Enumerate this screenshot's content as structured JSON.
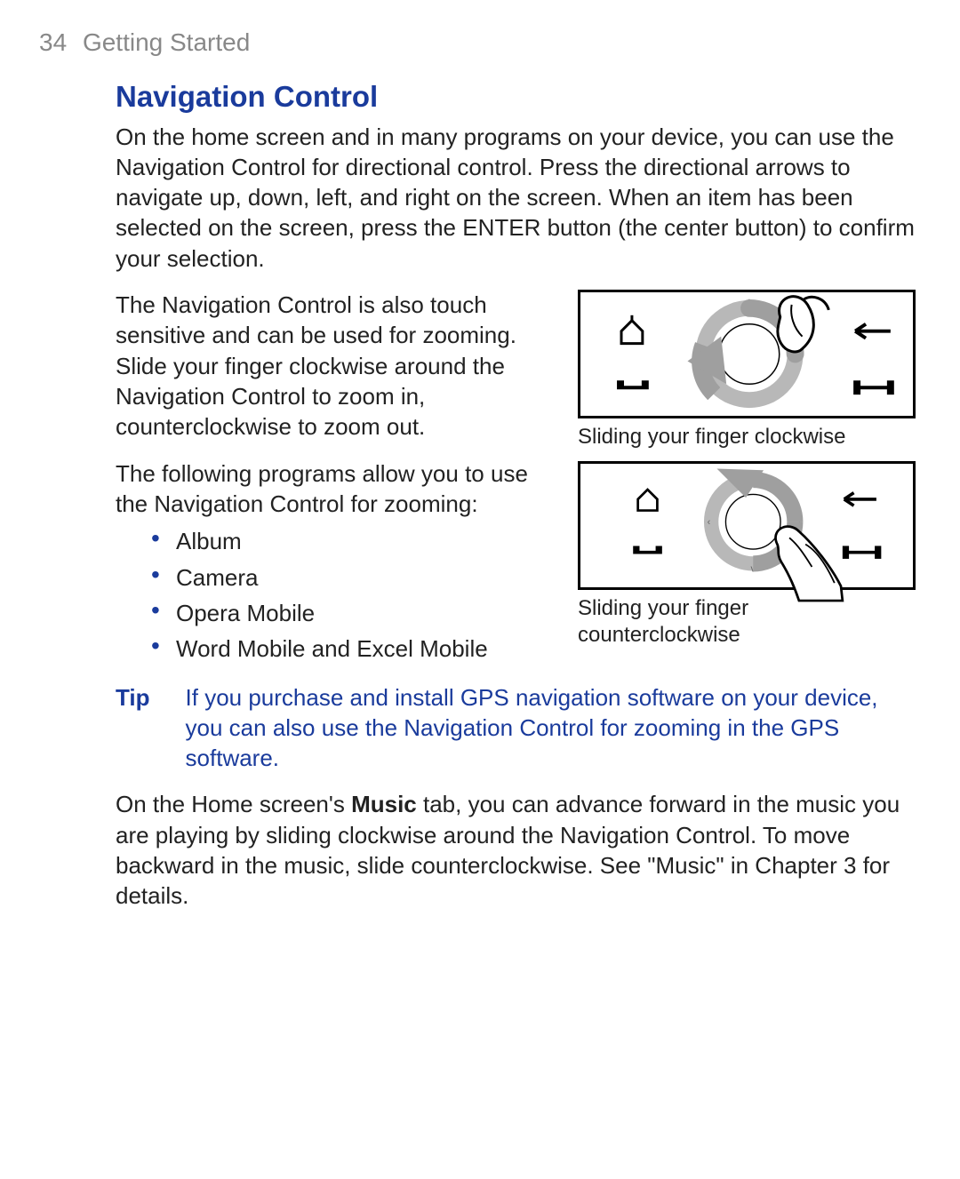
{
  "header": {
    "page_number": "34",
    "chapter": "Getting Started"
  },
  "section_title": "Navigation Control",
  "intro": "On the home screen and in many programs on your device, you can use the Navigation Control for directional control. Press the directional arrows to navigate up, down, left, and right on the screen. When an item has been selected on the screen, press the ENTER button (the center button) to confirm your selection.",
  "touch_para": "The Navigation Control is also touch sensitive and can be used for zooming. Slide your finger clockwise around the Navigation Control to zoom in, counterclockwise to zoom out.",
  "programs_intro": "The following programs allow you to use the Navigation Control for zooming:",
  "programs": [
    "Album",
    "Camera",
    "Opera Mobile",
    "Word Mobile and Excel Mobile"
  ],
  "figures": {
    "clockwise_caption": "Sliding your finger clockwise",
    "counterclockwise_caption": "Sliding your finger counterclockwise"
  },
  "tip": {
    "label": "Tip",
    "text": "If you purchase and install GPS navigation software on your device, you can also use the Navigation Control for zooming in the GPS software."
  },
  "music": {
    "prefix": "On the Home screen's ",
    "bold": "Music",
    "suffix": " tab, you can advance forward in the music you are playing by sliding clockwise around the Navigation Control. To move backward in the music, slide counterclockwise. See \"Music\" in Chapter 3 for details."
  }
}
